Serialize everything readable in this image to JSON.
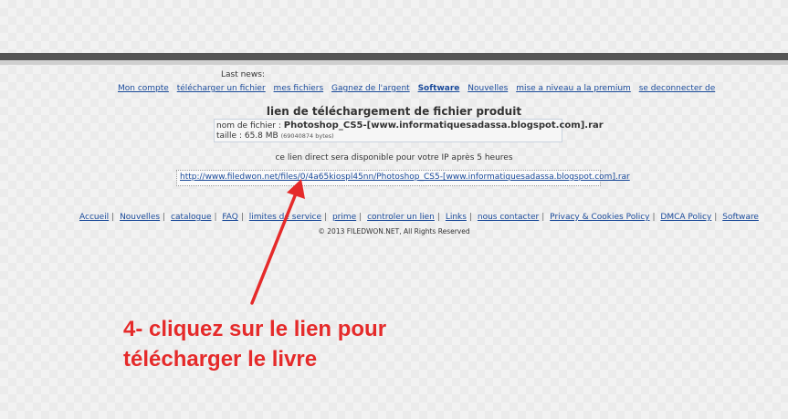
{
  "header": {
    "last_news_label": "Last news:"
  },
  "nav": {
    "items": [
      {
        "label": "Mon compte"
      },
      {
        "label": "télécharger un fichier"
      },
      {
        "label": "mes fichiers"
      },
      {
        "label": "Gagnez de l'argent"
      },
      {
        "label": "Software"
      },
      {
        "label": "Nouvelles"
      },
      {
        "label": "mise a niveau a la premium"
      },
      {
        "label": "se deconnecter de"
      }
    ]
  },
  "main": {
    "heading": "lien de téléchargement de fichier produit",
    "file_name_label": "nom de fichier : ",
    "file_name": "Photoshop_CS5-[www.informatiquesadassa.blogspot.com].rar",
    "size_label": "taille : ",
    "size": "65.8 MB",
    "size_bytes": "(69040874 bytes)",
    "notice": "ce lien direct sera disponible pour votre IP après 5 heures",
    "download_link": "http://www.filedwon.net/files/0/4a65kiospl45nn/Photoshop_CS5-[www.informatiquesadassa.blogspot.com].rar"
  },
  "footer": {
    "links": [
      {
        "label": "Accueil"
      },
      {
        "label": "Nouvelles"
      },
      {
        "label": "catalogue"
      },
      {
        "label": "FAQ"
      },
      {
        "label": "limites de service"
      },
      {
        "label": "prime"
      },
      {
        "label": "controler un lien"
      },
      {
        "label": "Links"
      },
      {
        "label": "nous contacter"
      },
      {
        "label": "Privacy & Cookies Policy"
      },
      {
        "label": "DMCA Policy"
      },
      {
        "label": "Software"
      }
    ],
    "separator": "|",
    "copyright": "© 2013 FILEDWON.NET, All Rights Reserved"
  },
  "annotation": {
    "line1": "4- cliquez sur le lien pour",
    "line2": "télécharger le livre",
    "color": "#e52a2a"
  },
  "colors": {
    "link": "#1a4a9a",
    "top_bar": "#555555"
  }
}
